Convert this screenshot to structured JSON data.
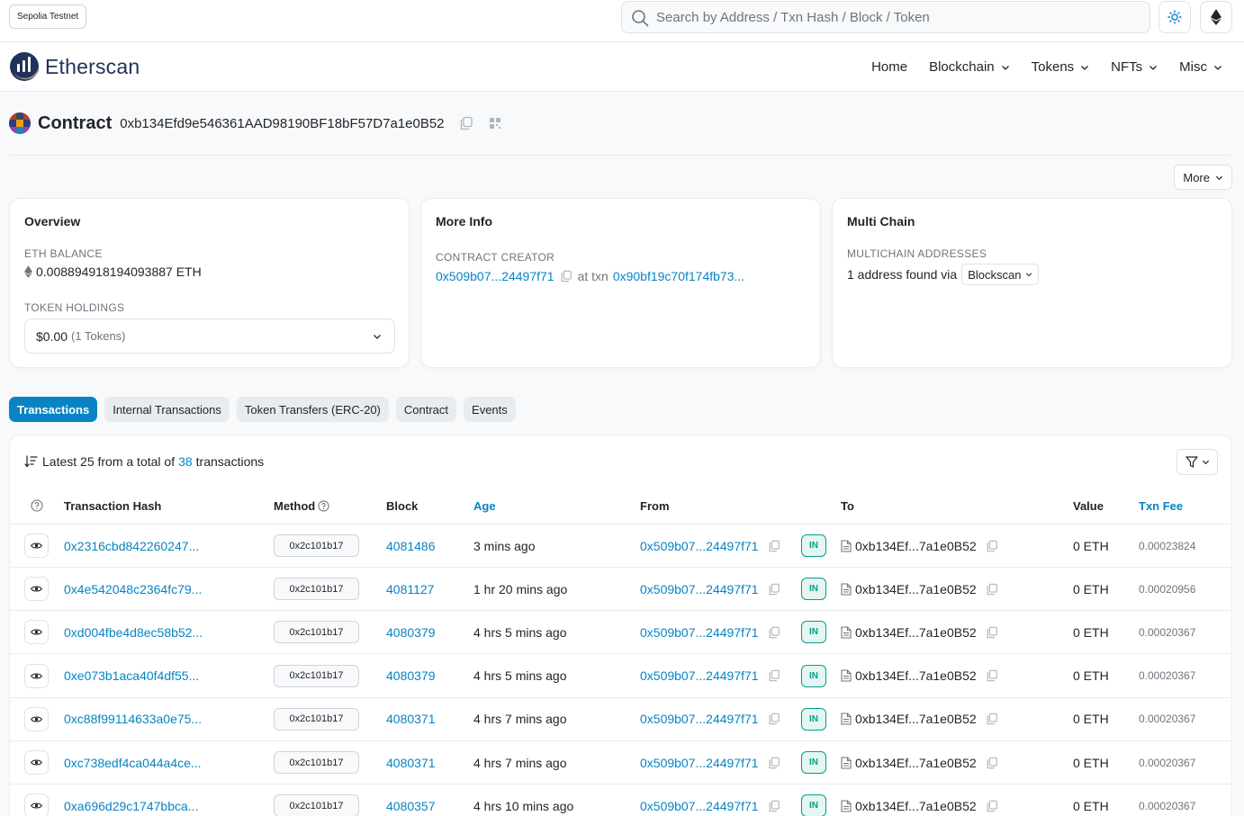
{
  "topbar": {
    "network": "Sepolia Testnet",
    "search_placeholder": "Search by Address / Txn Hash / Block / Token"
  },
  "header": {
    "logo_text": "Etherscan",
    "nav": [
      {
        "label": "Home",
        "dropdown": false
      },
      {
        "label": "Blockchain",
        "dropdown": true
      },
      {
        "label": "Tokens",
        "dropdown": true
      },
      {
        "label": "NFTs",
        "dropdown": true
      },
      {
        "label": "Misc",
        "dropdown": true
      }
    ]
  },
  "page": {
    "title": "Contract",
    "address": "0xb134Efd9e546361AAD98190BF18bF57D7a1e0B52",
    "more_label": "More"
  },
  "overview": {
    "title": "Overview",
    "balance_label": "ETH BALANCE",
    "balance_value": "0.008894918194093887 ETH",
    "holdings_label": "TOKEN HOLDINGS",
    "holdings_value": "$0.00",
    "holdings_count": "(1 Tokens)"
  },
  "more_info": {
    "title": "More Info",
    "creator_label": "CONTRACT CREATOR",
    "creator_address": "0x509b07...24497f71",
    "at_txn": "at txn",
    "creator_txn": "0x90bf19c70f174fb73..."
  },
  "multi_chain": {
    "title": "Multi Chain",
    "label": "MULTICHAIN ADDRESSES",
    "found_text": "1 address found via",
    "blockscan_label": "Blockscan"
  },
  "tabs": [
    {
      "label": "Transactions",
      "active": true
    },
    {
      "label": "Internal Transactions",
      "active": false
    },
    {
      "label": "Token Transfers (ERC-20)",
      "active": false
    },
    {
      "label": "Contract",
      "active": false
    },
    {
      "label": "Events",
      "active": false
    }
  ],
  "table": {
    "summary_prefix": "Latest 25 from a total of",
    "summary_count": "38",
    "summary_suffix": "transactions",
    "headers": {
      "hash": "Transaction Hash",
      "method": "Method",
      "block": "Block",
      "age": "Age",
      "from": "From",
      "to": "To",
      "value": "Value",
      "fee": "Txn Fee"
    },
    "rows": [
      {
        "hash": "0x2316cbd842260247...",
        "method": "0x2c101b17",
        "block": "4081486",
        "age": "3 mins ago",
        "from": "0x509b07...24497f71",
        "direction": "IN",
        "to": "0xb134Ef...7a1e0B52",
        "value": "0 ETH",
        "fee": "0.00023824"
      },
      {
        "hash": "0x4e542048c2364fc79...",
        "method": "0x2c101b17",
        "block": "4081127",
        "age": "1 hr 20 mins ago",
        "from": "0x509b07...24497f71",
        "direction": "IN",
        "to": "0xb134Ef...7a1e0B52",
        "value": "0 ETH",
        "fee": "0.00020956"
      },
      {
        "hash": "0xd004fbe4d8ec58b52...",
        "method": "0x2c101b17",
        "block": "4080379",
        "age": "4 hrs 5 mins ago",
        "from": "0x509b07...24497f71",
        "direction": "IN",
        "to": "0xb134Ef...7a1e0B52",
        "value": "0 ETH",
        "fee": "0.00020367"
      },
      {
        "hash": "0xe073b1aca40f4df55...",
        "method": "0x2c101b17",
        "block": "4080379",
        "age": "4 hrs 5 mins ago",
        "from": "0x509b07...24497f71",
        "direction": "IN",
        "to": "0xb134Ef...7a1e0B52",
        "value": "0 ETH",
        "fee": "0.00020367"
      },
      {
        "hash": "0xc88f99114633a0e75...",
        "method": "0x2c101b17",
        "block": "4080371",
        "age": "4 hrs 7 mins ago",
        "from": "0x509b07...24497f71",
        "direction": "IN",
        "to": "0xb134Ef...7a1e0B52",
        "value": "0 ETH",
        "fee": "0.00020367"
      },
      {
        "hash": "0xc738edf4ca044a4ce...",
        "method": "0x2c101b17",
        "block": "4080371",
        "age": "4 hrs 7 mins ago",
        "from": "0x509b07...24497f71",
        "direction": "IN",
        "to": "0xb134Ef...7a1e0B52",
        "value": "0 ETH",
        "fee": "0.00020367"
      },
      {
        "hash": "0xa696d29c1747bbca...",
        "method": "0x2c101b17",
        "block": "4080357",
        "age": "4 hrs 10 mins ago",
        "from": "0x509b07...24497f71",
        "direction": "IN",
        "to": "0xb134Ef...7a1e0B52",
        "value": "0 ETH",
        "fee": "0.00020367"
      }
    ]
  },
  "colors": {
    "link": "#0784c3",
    "brand": "#21325b",
    "in_badge": "#00a186"
  }
}
